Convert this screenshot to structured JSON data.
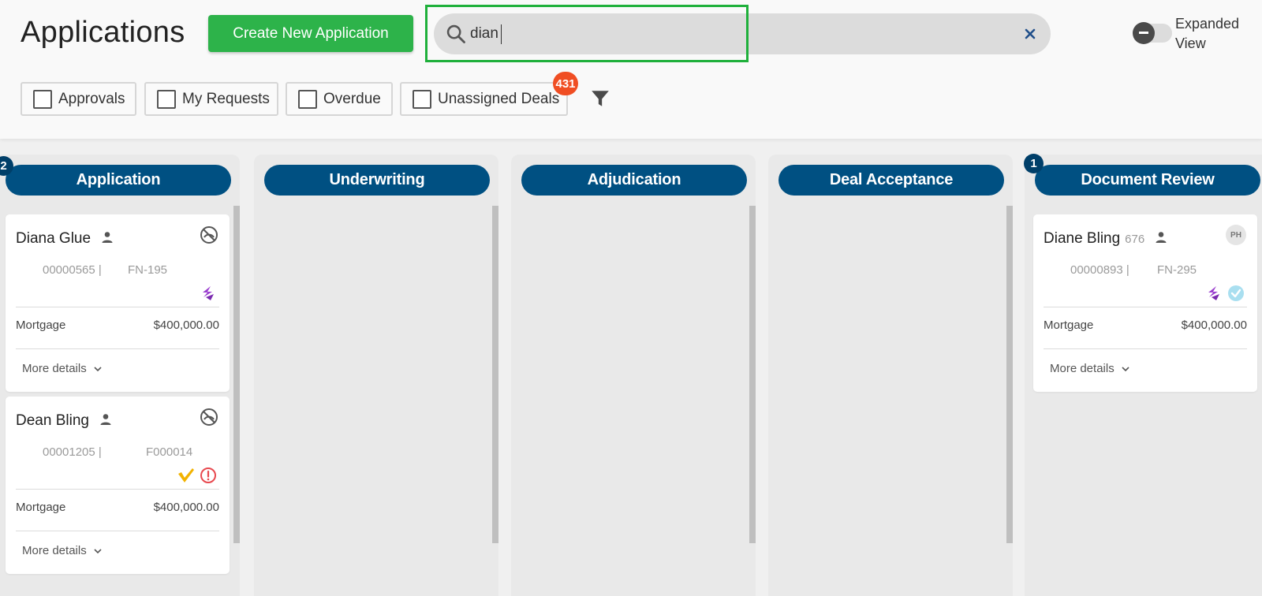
{
  "header": {
    "title": "Applications",
    "create_button": "Create New Application",
    "search": {
      "value": "dian",
      "placeholder": ""
    },
    "expanded_view_label": "Expanded View",
    "expanded_view_on": false
  },
  "filters": {
    "chips": [
      {
        "label": "Approvals",
        "checked": false
      },
      {
        "label": "My Requests",
        "checked": false
      },
      {
        "label": "Overdue",
        "checked": false
      },
      {
        "label": "Unassigned Deals",
        "checked": false,
        "badge": "431"
      }
    ]
  },
  "colors": {
    "accent_green": "#2db34a",
    "column_header": "#005082",
    "badge_orange": "#f04e23",
    "highlight": "#1fb03b"
  },
  "columns": [
    {
      "title": "Application",
      "count": "2",
      "cards": [
        {
          "name": "Diana Glue",
          "num": "",
          "id": "00000565 |",
          "ref": "FN-195",
          "corner_icon": "no-signal-icon",
          "status_icons": [
            "quill-icon"
          ],
          "type": "Mortgage",
          "amount": "$400,000.00",
          "more": "More details"
        },
        {
          "name": "Dean Bling",
          "num": "",
          "id": "00001205 |",
          "ref": "F000014",
          "corner_icon": "no-signal-icon",
          "status_icons": [
            "check-icon",
            "alert-icon"
          ],
          "type": "Mortgage",
          "amount": "$400,000.00",
          "more": "More details"
        }
      ]
    },
    {
      "title": "Underwriting",
      "count": "",
      "cards": []
    },
    {
      "title": "Adjudication",
      "count": "",
      "cards": []
    },
    {
      "title": "Deal Acceptance",
      "count": "",
      "cards": []
    },
    {
      "title": "Document Review",
      "count": "1",
      "cards": [
        {
          "name": "Diane Bling",
          "num": "676",
          "id": "00000893 |",
          "ref": "FN-295",
          "corner_badge": "PH",
          "status_icons": [
            "quill-icon",
            "verified-icon"
          ],
          "type": "Mortgage",
          "amount": "$400,000.00",
          "more": "More details"
        }
      ]
    }
  ]
}
